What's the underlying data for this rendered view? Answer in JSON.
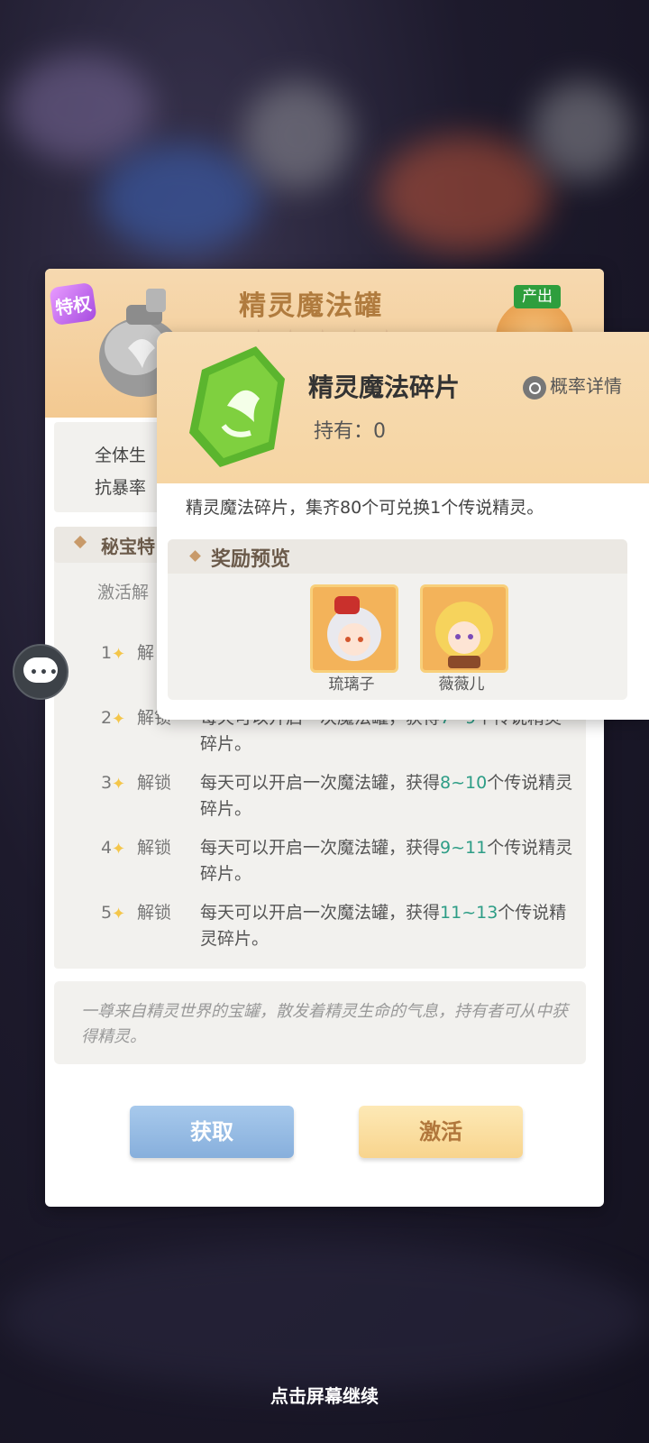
{
  "background": {
    "continue_hint": "点击屏幕继续"
  },
  "item_panel": {
    "privilege_badge": "特权",
    "title": "精灵魔法罐",
    "stars": "★★★★★",
    "produce_label": "产出",
    "attr_line1": "全体生",
    "attr_line2": "抗暴率",
    "secret_section_label": "秘宝特",
    "activate_hint": "激活解",
    "unlock_rows": [
      {
        "num": "1",
        "label": "解",
        "desc_prefix": "",
        "range": "",
        "desc_suffix": ""
      },
      {
        "num": "2",
        "label": "解锁",
        "desc_prefix": "每天可以开启一次魔法罐，获得",
        "range": "7~9",
        "desc_suffix": "个传说精灵碎片。"
      },
      {
        "num": "3",
        "label": "解锁",
        "desc_prefix": "每天可以开启一次魔法罐，获得",
        "range": "8~10",
        "desc_suffix": "个传说精灵碎片。"
      },
      {
        "num": "4",
        "label": "解锁",
        "desc_prefix": "每天可以开启一次魔法罐，获得",
        "range": "9~11",
        "desc_suffix": "个传说精灵碎片。"
      },
      {
        "num": "5",
        "label": "解锁",
        "desc_prefix": "每天可以开启一次魔法罐，获得",
        "range": "11~13",
        "desc_suffix": "个传说精灵碎片。"
      }
    ],
    "flavor_text": "一尊来自精灵世界的宝罐，散发着精灵生命的气息，持有者可从中获得精灵。",
    "get_button": "获取",
    "activate_button": "激活"
  },
  "shard_popup": {
    "title": "精灵魔法碎片",
    "hold_label": "持有：0",
    "prob_details": "概率详情",
    "description": "精灵魔法碎片，集齐80个可兑换1个传说精灵。",
    "reward_preview_label": "奖励预览",
    "rewards": [
      {
        "name": "琉璃子"
      },
      {
        "name": "薇薇儿"
      }
    ]
  }
}
